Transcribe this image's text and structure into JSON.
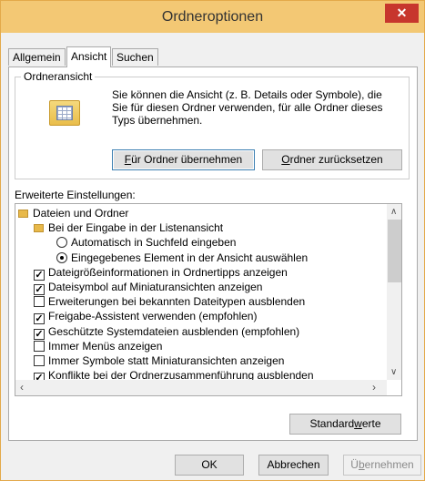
{
  "window": {
    "title": "Ordneroptionen",
    "close_glyph": "✕"
  },
  "tabs": [
    "Allgemein",
    "Ansicht",
    "Suchen"
  ],
  "folder_view": {
    "title": "Ordneransicht",
    "description": "Sie können die Ansicht (z. B. Details oder Symbole), die Sie für diesen Ordner verwenden, für alle Ordner dieses Typs übernehmen.",
    "apply_pre": "",
    "apply_key": "F",
    "apply_post": "ür Ordner übernehmen",
    "reset_pre": "",
    "reset_key": "O",
    "reset_post": "rdner zurücksetzen",
    "icon": "folder-view-icon"
  },
  "advanced": {
    "label": "Erweiterte Einstellungen:",
    "items": [
      {
        "type": "folder",
        "indent": 0,
        "text": "Dateien und Ordner"
      },
      {
        "type": "folder",
        "indent": 1,
        "text": "Bei der Eingabe in der Listenansicht"
      },
      {
        "type": "radio",
        "indent": 2,
        "checked": false,
        "text": "Automatisch in Suchfeld eingeben"
      },
      {
        "type": "radio",
        "indent": 2,
        "checked": true,
        "text": "Eingegebenes Element in der Ansicht auswählen"
      },
      {
        "type": "checkbox",
        "indent": 1,
        "checked": true,
        "text": "Dateigrößeinformationen in Ordnertipps anzeigen"
      },
      {
        "type": "checkbox",
        "indent": 1,
        "checked": true,
        "text": "Dateisymbol auf Miniaturansichten anzeigen"
      },
      {
        "type": "checkbox",
        "indent": 1,
        "checked": false,
        "text": "Erweiterungen bei bekannten Dateitypen ausblenden"
      },
      {
        "type": "checkbox",
        "indent": 1,
        "checked": true,
        "text": "Freigabe-Assistent verwenden (empfohlen)"
      },
      {
        "type": "checkbox",
        "indent": 1,
        "checked": true,
        "text": "Geschützte Systemdateien ausblenden (empfohlen)"
      },
      {
        "type": "checkbox",
        "indent": 1,
        "checked": false,
        "text": "Immer Menüs anzeigen"
      },
      {
        "type": "checkbox",
        "indent": 1,
        "checked": false,
        "text": "Immer Symbole statt Miniaturansichten anzeigen"
      },
      {
        "type": "checkbox",
        "indent": 1,
        "checked": true,
        "text": "Konflikte bei der Ordnerzusammenführung ausblenden"
      }
    ],
    "defaults_pre": "Standard",
    "defaults_key": "w",
    "defaults_post": "erte"
  },
  "footer": {
    "ok": "OK",
    "cancel": "Abbrechen",
    "apply_pre": "Ü",
    "apply_key": "b",
    "apply_post": "ernehmen"
  },
  "colors": {
    "titlebar": "#f3c874",
    "close": "#c7362d"
  }
}
